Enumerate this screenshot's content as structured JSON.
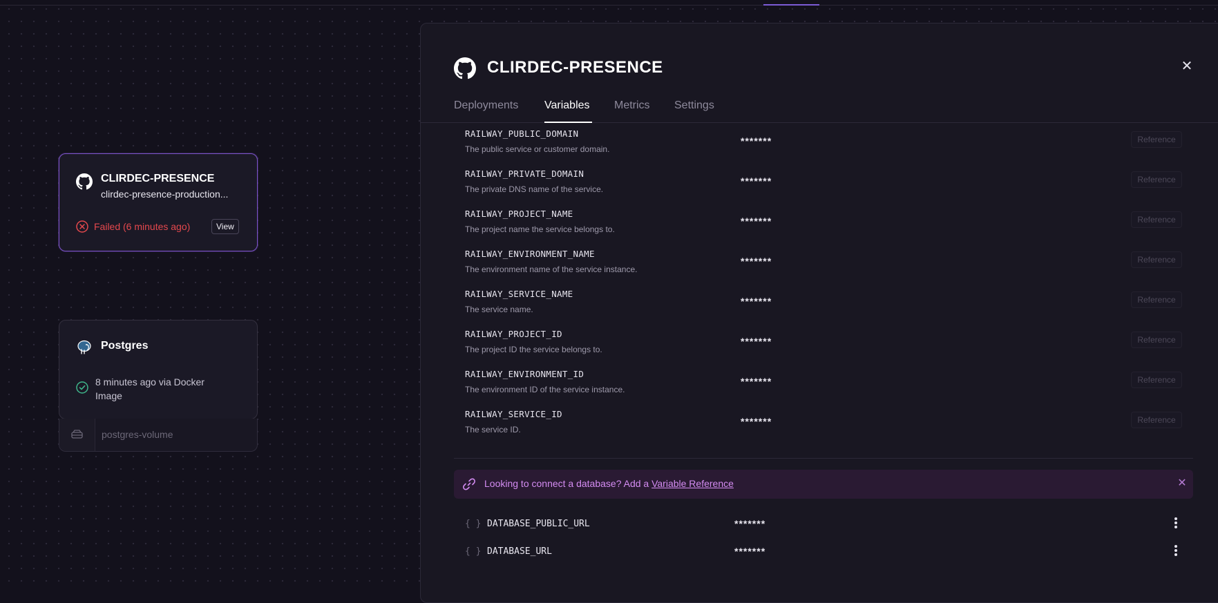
{
  "canvas": {
    "services": [
      {
        "name": "CLIRDEC-PRESENCE",
        "domain": "clirdec-presence-production...",
        "status": "Failed (6 minutes ago)",
        "view_label": "View",
        "icon": "github-icon"
      },
      {
        "name": "Postgres",
        "status": "8 minutes ago via Docker Image",
        "icon": "postgres-elephant-icon",
        "volume": "postgres-volume"
      }
    ]
  },
  "panel": {
    "title": "CLIRDEC-PRESENCE",
    "tabs": [
      {
        "label": "Deployments"
      },
      {
        "label": "Variables"
      },
      {
        "label": "Metrics"
      },
      {
        "label": "Settings"
      }
    ],
    "active_tab": "Variables",
    "railway_variables": [
      {
        "name": "RAILWAY_PUBLIC_DOMAIN",
        "description": "The public service or customer domain.",
        "value": "*******",
        "action": "Reference"
      },
      {
        "name": "RAILWAY_PRIVATE_DOMAIN",
        "description": "The private DNS name of the service.",
        "value": "*******",
        "action": "Reference"
      },
      {
        "name": "RAILWAY_PROJECT_NAME",
        "description": "The project name the service belongs to.",
        "value": "*******",
        "action": "Reference"
      },
      {
        "name": "RAILWAY_ENVIRONMENT_NAME",
        "description": "The environment name of the service instance.",
        "value": "*******",
        "action": "Reference"
      },
      {
        "name": "RAILWAY_SERVICE_NAME",
        "description": "The service name.",
        "value": "*******",
        "action": "Reference"
      },
      {
        "name": "RAILWAY_PROJECT_ID",
        "description": "The project ID the service belongs to.",
        "value": "*******",
        "action": "Reference"
      },
      {
        "name": "RAILWAY_ENVIRONMENT_ID",
        "description": "The environment ID of the service instance.",
        "value": "*******",
        "action": "Reference"
      },
      {
        "name": "RAILWAY_SERVICE_ID",
        "description": "The service ID.",
        "value": "*******",
        "action": "Reference"
      }
    ],
    "banner": {
      "text": "Looking to connect a database? Add a ",
      "link": "Variable Reference"
    },
    "user_variables": [
      {
        "brace": "{ }",
        "name": "DATABASE_PUBLIC_URL",
        "value": "*******"
      },
      {
        "brace": "{ }",
        "name": "DATABASE_URL",
        "value": "*******"
      }
    ]
  },
  "colors": {
    "background": "#13111c",
    "accent": "#7c5bd6",
    "failed": "#e5484d",
    "success": "#3fb68b",
    "banner_bg": "#2a1a33",
    "banner_text": "#d48cf2"
  }
}
